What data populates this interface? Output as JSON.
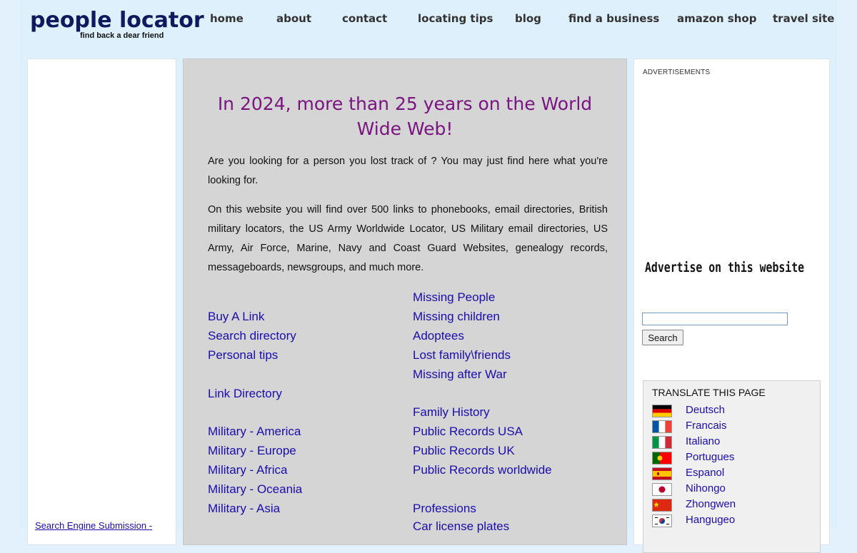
{
  "header": {
    "logo_title": "people locator",
    "logo_subtitle": "find back a dear friend",
    "nav": [
      {
        "label": "home"
      },
      {
        "label": "about"
      },
      {
        "label": "contact"
      },
      {
        "label": "locating tips"
      },
      {
        "label": "blog"
      },
      {
        "label": "find a business"
      },
      {
        "label": "amazon shop"
      },
      {
        "label": "travel site"
      }
    ]
  },
  "left": {
    "seo_link": "Search Engine Submission -"
  },
  "main": {
    "headline": "In 2024, more than 25 years on the World Wide Web!",
    "intro": "Are you looking for a person you lost track of ? You may just find here what you're looking for.",
    "description": "On this website you will find over 500 links to phonebooks, email directories, British military locators, the US Army Worldwide Locator, US Military email directories, US Army, Air Force, Marine, Navy and Coast Guard Websites, genealogy records, messageboards, newsgroups, and much more.",
    "links_left": [
      "Buy A Link",
      "Search directory",
      "Personal tips",
      "Link Directory",
      "Military - America",
      "Military - Europe",
      "Military - Africa",
      "Military - Oceania",
      "Military - Asia"
    ],
    "links_right": [
      "Missing People",
      "Missing children",
      "Adoptees",
      "Lost family\\friends",
      "Missing after War",
      "Family History",
      "Public Records USA",
      "Public Records UK",
      "Public Records worldwide",
      "Professions",
      "Car license plates"
    ]
  },
  "right": {
    "ads_label": "ADVERTISEMENTS",
    "advertise_text": "Advertise on this website",
    "search": {
      "value": "",
      "button_label": "Search"
    },
    "translate": {
      "title": "TRANSLATE THIS PAGE",
      "languages": [
        {
          "label": "Deutsch",
          "flag": "flag-germany-icon"
        },
        {
          "label": "Francais",
          "flag": "flag-france-icon"
        },
        {
          "label": "Italiano",
          "flag": "flag-italy-icon"
        },
        {
          "label": "Portugues",
          "flag": "flag-portugal-icon"
        },
        {
          "label": "Espanol",
          "flag": "flag-spain-icon"
        },
        {
          "label": "Nihongo",
          "flag": "flag-japan-icon"
        },
        {
          "label": "Zhongwen",
          "flag": "flag-china-icon"
        },
        {
          "label": "Hangugeo",
          "flag": "flag-korea-icon"
        }
      ]
    }
  }
}
